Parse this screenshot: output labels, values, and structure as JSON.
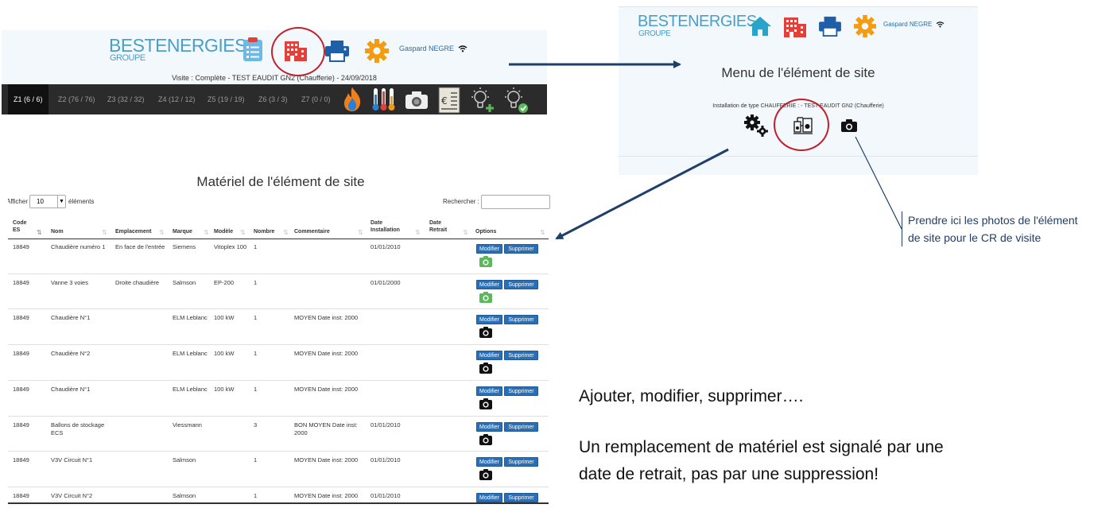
{
  "app1": {
    "logo_main_a": "BEST",
    "logo_main_b": "ENERGIES",
    "logo_sub": "GROUPE",
    "user": "Gaspard NEGRE",
    "visit": "Visite : Complète - TEST EAUDIT GN2 (Chaufferie) - 24/09/2018",
    "zones": [
      "Z1 (6 / 6)",
      "Z2 (76 / 76)",
      "Z3 (32 / 32)",
      "Z4 (12 / 12)",
      "Z5 (19 / 19)",
      "Z6 (3 / 3)",
      "Z7 (0 / 0)"
    ]
  },
  "app2": {
    "logo_main_a": "BEST",
    "logo_main_b": "ENERGIES",
    "logo_sub": "GROUPE",
    "user": "Gaspard NEGRE",
    "menu_title": "Menu de l'élément de site",
    "install": "Installation de type CHAUFFERIE : - TEST EAUDIT GN2 (Chaufferie)"
  },
  "note": "Prendre ici les photos de l'élément de site pour le CR de visite",
  "table": {
    "title": "Matériel de l'élément de site",
    "show_prefix": "Afficher",
    "show_value": "10",
    "show_suffix": "éléments",
    "search_label": "Rechercher :",
    "headers": [
      "Code ES",
      "Nom",
      "Emplacement",
      "Marque",
      "Modèle",
      "Nombre",
      "Commentaire",
      "Date Installation",
      "Date Retrait",
      "Options"
    ],
    "btn_edit": "Modifier",
    "btn_delete": "Supprimer",
    "rows": [
      {
        "code": "18849",
        "nom": "Chaudière numéro 1",
        "emplacement": "En face de l'entrée",
        "marque": "Siemens",
        "modele": "Vitoplex 100",
        "nombre": "1",
        "commentaire": "",
        "date_install": "01/01/2010",
        "date_retrait": "",
        "photo": "green"
      },
      {
        "code": "18849",
        "nom": "Vanne 3 voies",
        "emplacement": "Droite chaudière",
        "marque": "Salmson",
        "modele": "EP-200",
        "nombre": "1",
        "commentaire": "",
        "date_install": "01/01/2000",
        "date_retrait": "",
        "photo": "green"
      },
      {
        "code": "18849",
        "nom": "Chaudière N°1",
        "emplacement": "",
        "marque": "ELM Leblanc",
        "modele": "100 kW",
        "nombre": "1",
        "commentaire": "MOYEN Date inst: 2000",
        "date_install": "",
        "date_retrait": "",
        "photo": "black"
      },
      {
        "code": "18849",
        "nom": "Chaudière N°2",
        "emplacement": "",
        "marque": "ELM Leblanc",
        "modele": "100 kW",
        "nombre": "1",
        "commentaire": "MOYEN Date inst: 2000",
        "date_install": "",
        "date_retrait": "",
        "photo": "black"
      },
      {
        "code": "18849",
        "nom": "Chaudière N°1",
        "emplacement": "",
        "marque": "ELM Leblanc",
        "modele": "100 kW",
        "nombre": "1",
        "commentaire": "MOYEN Date inst: 2000",
        "date_install": "",
        "date_retrait": "",
        "photo": "black"
      },
      {
        "code": "18849",
        "nom": "Ballons de stockage ECS",
        "emplacement": "",
        "marque": "Viessmann",
        "modele": "",
        "nombre": "3",
        "commentaire": "BON MOYEN Date inst: 2000",
        "date_install": "01/01/2010",
        "date_retrait": "",
        "photo": "black"
      },
      {
        "code": "18849",
        "nom": "V3V Circuit N°1",
        "emplacement": "",
        "marque": "Salmson",
        "modele": "",
        "nombre": "1",
        "commentaire": "MOYEN Date inst: 2000",
        "date_install": "01/01/2010",
        "date_retrait": "",
        "photo": "black"
      },
      {
        "code": "18849",
        "nom": "V3V Circuit N°2",
        "emplacement": "",
        "marque": "Salmson",
        "modele": "",
        "nombre": "1",
        "commentaire": "MOYEN Date inst: 2000",
        "date_install": "01/01/2010",
        "date_retrait": "",
        "photo": "none"
      }
    ]
  },
  "right_text": {
    "line1": "Ajouter, modifier, supprimer….",
    "line2": "Un remplacement de matériel est signalé par une",
    "line3": "date de retrait, pas par une suppression!"
  },
  "colors": {
    "brand_blue": "#4a9fc9",
    "button_blue": "#2a6fb5",
    "highlight_red": "#c0202a",
    "arrow_navy": "#1f3f6a",
    "camera_green": "#5cb85c",
    "gear_orange": "#f39c12",
    "home_teal": "#2aa3c9",
    "building_red": "#e0413a",
    "printer_blue": "#1f5fa8"
  }
}
